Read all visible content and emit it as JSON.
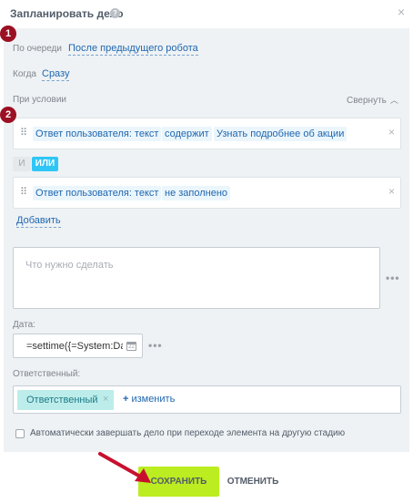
{
  "dialog": {
    "title": "Запланировать дело",
    "help_icon": "help-icon",
    "close_glyph": "×"
  },
  "markers": [
    "1",
    "2"
  ],
  "queue": {
    "label": "По очереди",
    "value": "После предыдущего робота"
  },
  "when": {
    "label": "Когда",
    "value": "Сразу"
  },
  "condition": {
    "label": "При условии",
    "collapse_label": "Свернуть",
    "drag_glyph": "⠿",
    "remove_glyph": "×",
    "rows": [
      {
        "field": "Ответ пользователя: текст",
        "operator": "содержит",
        "value": "Узнать подробнее об акции"
      },
      {
        "field": "Ответ пользователя: текст",
        "operator": "не заполнено",
        "value": ""
      }
    ],
    "and_label": "И",
    "or_label": "ИЛИ",
    "add_label": "Добавить"
  },
  "task": {
    "placeholder": "Что нужно сделать"
  },
  "date": {
    "label": "Дата:",
    "value": "=settime({=System:Da"
  },
  "responsible": {
    "label": "Ответственный:",
    "tag": "Ответственный",
    "tag_remove": "×",
    "change_plus": "+",
    "change_label": "изменить"
  },
  "auto_complete": {
    "label": "Автоматически завершать дело при переходе элемента на другую стадию",
    "checked": false
  },
  "buttons": {
    "save": "СОХРАНИТЬ",
    "cancel": "ОТМЕНИТЬ"
  },
  "colors": {
    "accent_green": "#bbed21",
    "marker_red": "#9b1022",
    "link_blue": "#2067b0",
    "or_blue": "#2fc6f6",
    "arrow_red": "#c8102e"
  }
}
